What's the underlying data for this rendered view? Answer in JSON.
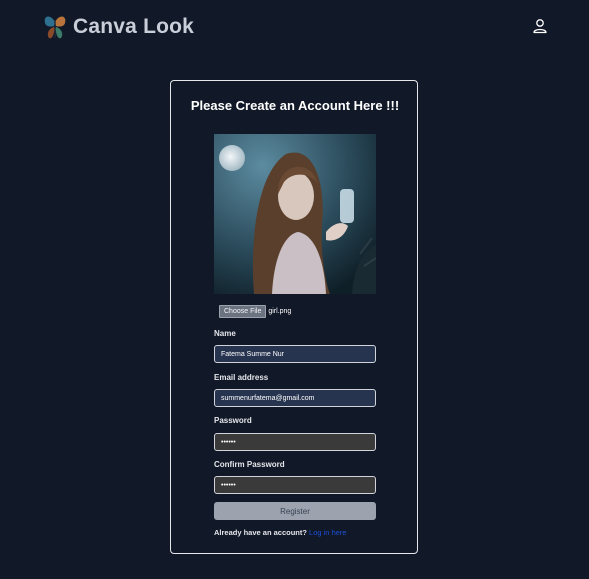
{
  "brand": {
    "name": "Canva Look"
  },
  "form": {
    "title": "Please Create an Account Here !!!",
    "file_button": "Choose File",
    "file_name": "girl.png",
    "name_label": "Name",
    "name_value": "Fatema Summe Nur",
    "email_label": "Email address",
    "email_value": "summenurfatema@gmail.com",
    "password_label": "Password",
    "password_value": "••••••",
    "confirm_label": "Confirm Password",
    "confirm_value": "••••••",
    "register_label": "Register",
    "login_prompt": "Already have an account?",
    "login_link": "Log in here"
  },
  "icons": {
    "brand": "butterfly-logo-icon",
    "user": "user-icon"
  },
  "colors": {
    "background": "#111827",
    "brand_text": "#c9ced8",
    "input_blue": "#273450",
    "input_gray": "#3a3a3a",
    "button": "#9ca3af",
    "link": "#1d4ed8"
  }
}
